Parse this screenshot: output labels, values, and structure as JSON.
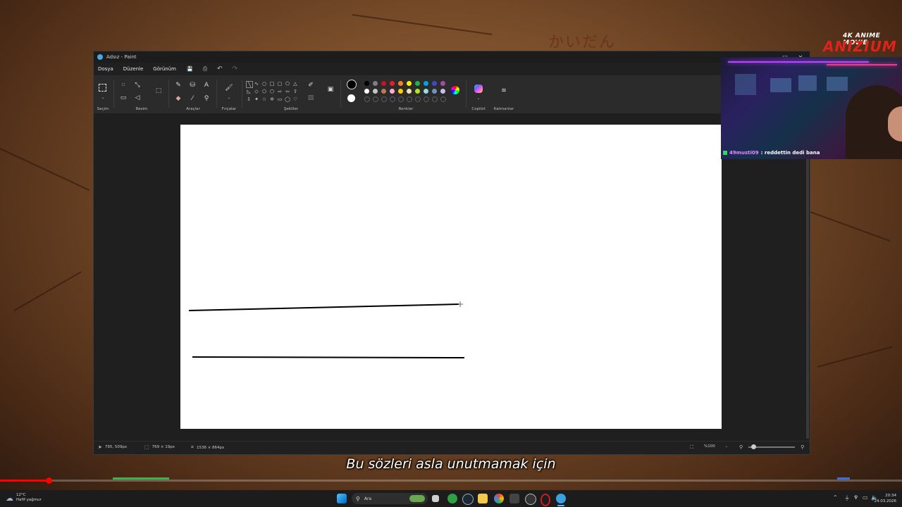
{
  "window": {
    "title": "Adsız - Paint",
    "minimize": "—",
    "maximize": "□",
    "close": "✕"
  },
  "menu": [
    "Dosya",
    "Düzenle",
    "Görünüm"
  ],
  "quick": {
    "save": "💾",
    "share": "⎙",
    "undo": "↶",
    "redo": "↷"
  },
  "ribbon": {
    "groups": {
      "selection": "Seçim",
      "image": "Resim",
      "tools": "Araçlar",
      "brushes": "Fırçalar",
      "shapes": "Şekiller",
      "colors": "Renkler",
      "copilot": "Copilot",
      "layers": "Katmanlar"
    },
    "palette": [
      "#000000",
      "#7f7f7f",
      "#c8102e",
      "#ed1c24",
      "#ff7f27",
      "#fff200",
      "#22b14c",
      "#00a2e8",
      "#3f48cc",
      "#a349a4",
      "#ffffff",
      "#c3c3c3",
      "#b97a57",
      "#ffaec9",
      "#ffc90e",
      "#efe4b0",
      "#b5e61d",
      "#99d9ea",
      "#7092be",
      "#c8bfe7"
    ],
    "primary_color": "#000000",
    "secondary_color": "#ffffff"
  },
  "status": {
    "cursor": "795, 509px",
    "selection": "769 × 19px",
    "canvas_size": "1536 × 864px",
    "zoom": "%100"
  },
  "overlay": {
    "brand_top": "4K ANIME MOVIE",
    "brand_main": "ANIZIUM",
    "chat_user": "49musti09",
    "chat_message": ": reddettin dedi bana",
    "watermark": "かいだん",
    "subtitle": "Bu sözleri asla unutmamak için"
  },
  "video_progress": 0.054,
  "taskbar": {
    "temperature": "12°C",
    "weather": "Hafif yağmur",
    "search_placeholder": "Ara",
    "time": "20:34",
    "date": "24.03.2026"
  }
}
